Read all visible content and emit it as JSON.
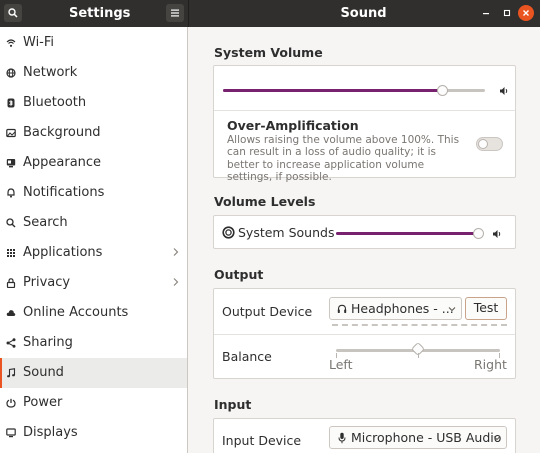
{
  "header": {
    "left_title": "Settings",
    "title": "Sound"
  },
  "sidebar": {
    "items": [
      {
        "label": "Wi-Fi",
        "icon": "wifi-icon"
      },
      {
        "label": "Network",
        "icon": "network-icon"
      },
      {
        "label": "Bluetooth",
        "icon": "bluetooth-icon"
      },
      {
        "label": "Background",
        "icon": "background-icon"
      },
      {
        "label": "Appearance",
        "icon": "appearance-icon"
      },
      {
        "label": "Notifications",
        "icon": "bell-icon"
      },
      {
        "label": "Search",
        "icon": "search-icon"
      },
      {
        "label": "Applications",
        "icon": "grid-icon",
        "has_submenu": true
      },
      {
        "label": "Privacy",
        "icon": "lock-icon",
        "has_submenu": true
      },
      {
        "label": "Online Accounts",
        "icon": "cloud-icon"
      },
      {
        "label": "Sharing",
        "icon": "share-icon"
      },
      {
        "label": "Sound",
        "icon": "music-note-icon",
        "active": true
      },
      {
        "label": "Power",
        "icon": "power-icon"
      },
      {
        "label": "Displays",
        "icon": "display-icon"
      }
    ]
  },
  "system_volume": {
    "title": "System Volume",
    "level": 0.84,
    "over_amplification": {
      "title": "Over-Amplification",
      "description": "Allows raising the volume above 100%. This can result in a loss of audio quality; it is better to increase application volume settings, if possible.",
      "enabled": false
    }
  },
  "volume_levels": {
    "title": "Volume Levels",
    "items": [
      {
        "label": "System Sounds",
        "level": 0.98
      }
    ]
  },
  "output": {
    "title": "Output",
    "device_label": "Output Device",
    "device_value": "Headphones - ...",
    "test_label": "Test",
    "balance_label": "Balance",
    "balance_left": "Left",
    "balance_right": "Right",
    "balance_value": 0.5
  },
  "input": {
    "title": "Input",
    "device_label": "Input Device",
    "device_value": "Microphone - USB Audio"
  },
  "colors": {
    "accent": "#e95420",
    "slider_fill": "#77216f",
    "headerbar": "#302f2d"
  }
}
